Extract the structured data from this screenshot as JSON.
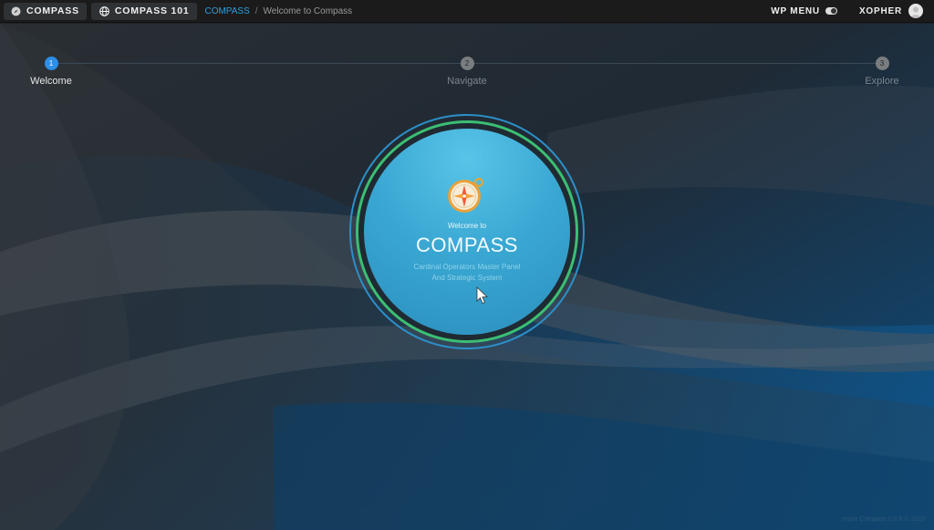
{
  "topbar": {
    "compass_label": "COMPASS",
    "compass101_label": "COMPASS 101",
    "breadcrumb": {
      "link": "COMPASS",
      "separator": "/",
      "current": "Welcome to Compass"
    },
    "wp_menu_label": "WP MENU",
    "user_name": "XOPHER"
  },
  "steps": [
    {
      "number": "1",
      "label": "Welcome",
      "state": "active"
    },
    {
      "number": "2",
      "label": "Navigate",
      "state": "inactive"
    },
    {
      "number": "3",
      "label": "Explore",
      "state": "inactive"
    }
  ],
  "hero": {
    "welcome": "Welcome to",
    "title": "COMPASS",
    "subtitle_line1": "Cardinal Operators Master Panel",
    "subtitle_line2": "And Strategic System",
    "icon": "compass-icon"
  },
  "footer": {
    "version": "Impix Compass 0.0.6 © 2016"
  },
  "colors": {
    "accent_blue": "#2d8fe6",
    "ring_blue": "#2c8fc8",
    "ring_green": "#3bbf73",
    "disc_blue": "#3aa8d3"
  }
}
